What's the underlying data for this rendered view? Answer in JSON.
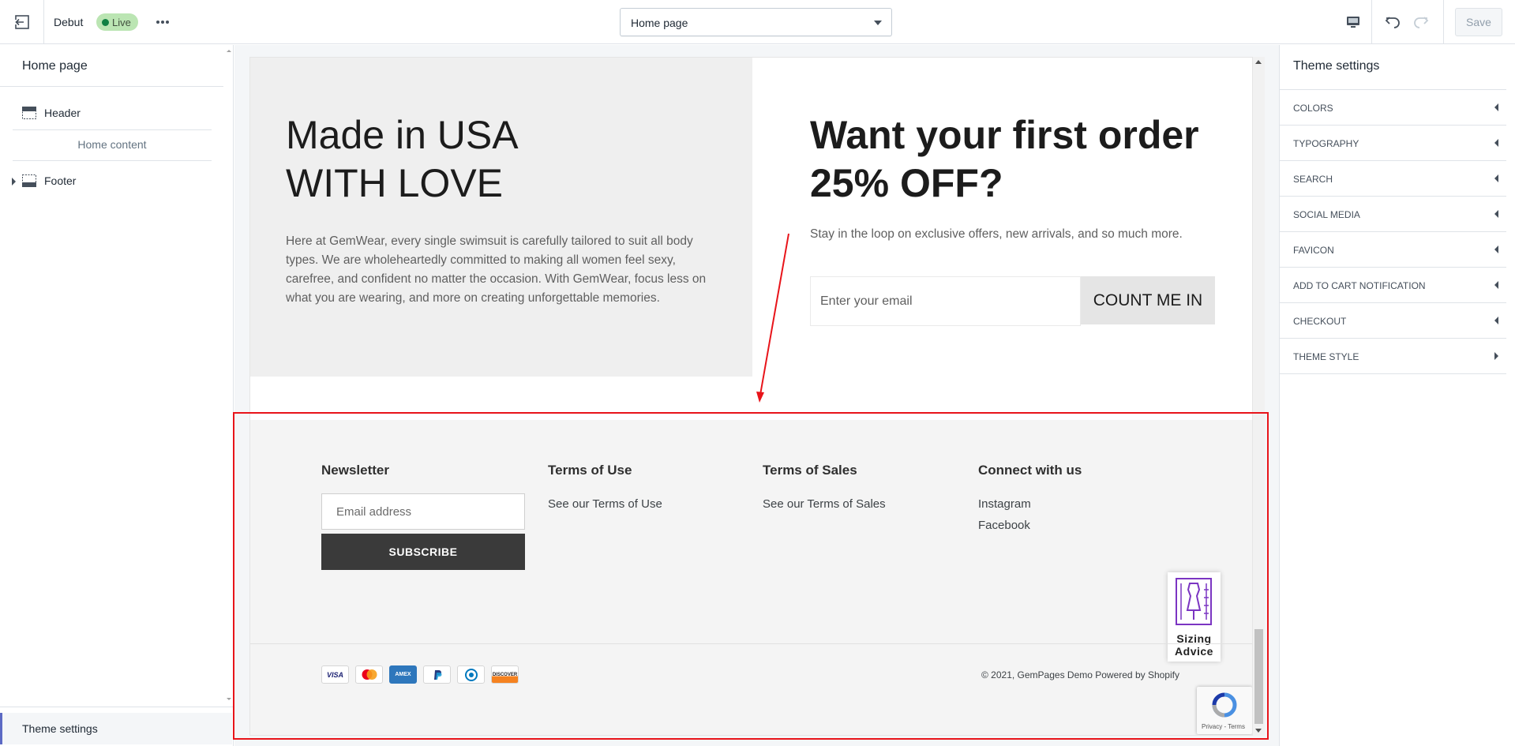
{
  "topbar": {
    "theme_name": "Debut",
    "status_badge": "Live",
    "page_select": "Home page",
    "save_label": "Save"
  },
  "left_sidebar": {
    "title": "Home page",
    "sections": [
      {
        "label": "Header",
        "icon": "header-section-icon"
      },
      {
        "label": "Home content"
      },
      {
        "label": "Footer",
        "icon": "footer-section-icon"
      }
    ],
    "theme_settings_label": "Theme settings"
  },
  "preview": {
    "promo": {
      "heading_line1": "Made in USA",
      "heading_line2": "WITH LOVE",
      "body": "Here at GemWear, every single swimsuit is carefully tailored to suit all body types. We are wholeheartedly committed to making all women feel sexy, carefree, and confident no matter the occasion. With GemWear, focus less on what you are wearing, and more on creating unforgettable memories."
    },
    "newsletter_promo": {
      "heading_line1": "Want your first order",
      "heading_line2": "25% OFF?",
      "subtext": "Stay in the loop on exclusive offers, new arrivals, and so much more.",
      "email_placeholder": "Enter your email",
      "button_label": "COUNT ME IN"
    },
    "footer": {
      "newsletter_heading": "Newsletter",
      "email_placeholder": "Email address",
      "subscribe_label": "SUBSCRIBE",
      "terms_use_heading": "Terms of Use",
      "terms_use_link": "See our Terms of Use",
      "terms_sales_heading": "Terms of Sales",
      "terms_sales_link": "See our Terms of Sales",
      "connect_heading": "Connect with us",
      "connect_links": [
        "Instagram",
        "Facebook"
      ],
      "payment_methods": [
        "VISA",
        "Mastercard",
        "AMEX",
        "PayPal",
        "Diners",
        "DISCOVER"
      ],
      "copyright": "© 2021, GemPages Demo Powered by Shopify",
      "sizing_advice_line1": "Sizing",
      "sizing_advice_line2": "Advice",
      "recaptcha_text": "Privacy - Terms"
    }
  },
  "right_sidebar": {
    "title": "Theme settings",
    "items": [
      {
        "label": "COLORS",
        "expanded": false
      },
      {
        "label": "TYPOGRAPHY",
        "expanded": false
      },
      {
        "label": "SEARCH",
        "expanded": false
      },
      {
        "label": "SOCIAL MEDIA",
        "expanded": false
      },
      {
        "label": "FAVICON",
        "expanded": false
      },
      {
        "label": "ADD TO CART NOTIFICATION",
        "expanded": false
      },
      {
        "label": "CHECKOUT",
        "expanded": false
      },
      {
        "label": "THEME STYLE",
        "expanded": false
      }
    ]
  },
  "colors": {
    "accent": "#5c6ac4",
    "live_badge": "#bbe5b3",
    "annotation": "#e8141a",
    "subscribe_button": "#3a3a3a"
  }
}
